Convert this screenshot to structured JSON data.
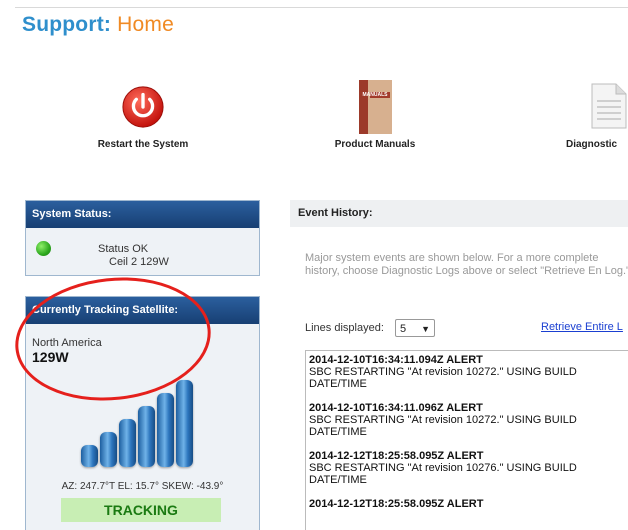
{
  "header": {
    "title_prefix": "Support:",
    "title_suffix": "Home"
  },
  "tiles": [
    {
      "label": "Restart the System",
      "icon": "power-icon"
    },
    {
      "label": "Product Manuals",
      "icon": "manual-book-icon",
      "book_text": "MANUALS"
    },
    {
      "label": "Diagnostic",
      "icon": "document-icon"
    }
  ],
  "system_status": {
    "heading": "System Status:",
    "status": "Status OK",
    "detail": "Ceil 2 129W"
  },
  "tracking": {
    "heading": "Currently Tracking Satellite:",
    "region": "North America",
    "satellite": "129W",
    "signal_bars": 6,
    "readout": "AZ: 247.7°T EL: 15.7° SKEW: -43.9°",
    "state_label": "TRACKING"
  },
  "events": {
    "heading": "Event History:",
    "description": "Major system events are shown below. For a more complete history, choose Diagnostic Logs above or select \"Retrieve En Log.\"",
    "lines_label": "Lines displayed:",
    "lines_value": "5",
    "retrieve_link": "Retrieve Entire L",
    "log": [
      {
        "head": "2014-12-10T16:34:11.094Z ALERT",
        "body": "SBC RESTARTING \"At revision 10272.\" USING BUILD DATE/TIME"
      },
      {
        "head": "2014-12-10T16:34:11.096Z ALERT",
        "body": "SBC RESTARTING \"At revision 10272.\" USING BUILD DATE/TIME"
      },
      {
        "head": "2014-12-12T18:25:58.095Z ALERT",
        "body": "SBC RESTARTING \"At revision 10276.\" USING BUILD DATE/TIME"
      },
      {
        "head": "2014-12-12T18:25:58.095Z ALERT",
        "body": ""
      }
    ]
  },
  "colors": {
    "title_blue": "#2f8fcc",
    "title_orange": "#f08a24",
    "panel_header": "#1f4f8a",
    "tracking_green": "#c8eeb4",
    "annotation_red": "#e5201c"
  }
}
